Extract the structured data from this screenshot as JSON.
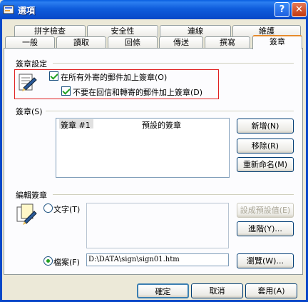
{
  "window": {
    "title": "選項",
    "help": "?",
    "close": "✕"
  },
  "tabs_row1": [
    "拼字檢查",
    "安全性",
    "連線",
    "維護"
  ],
  "tabs_row2": [
    "一般",
    "讀取",
    "回條",
    "傳送",
    "撰寫",
    "簽章"
  ],
  "signature_settings": {
    "label": "簽章設定",
    "add_to_all": "在所有外寄的郵件加上簽章(O)",
    "not_on_reply": "不要在回信和轉寄的郵件加上簽章(D)"
  },
  "signatures": {
    "label": "簽章(S)",
    "items": [
      {
        "name": "簽章 #1",
        "default": "預設的簽章"
      }
    ],
    "new": "新增(N)",
    "remove": "移除(R)",
    "rename": "重新命名(M)"
  },
  "edit_signature": {
    "label": "編輯簽章",
    "text_option": "文字(T)",
    "file_option": "檔案(F)",
    "file_path": "D:\\DATA\\sign\\sign01.htm",
    "set_default": "設成預設值(E)",
    "advanced": "進階(Y)...",
    "browse": "瀏覽(W)..."
  },
  "footer": {
    "ok": "確定",
    "cancel": "取消",
    "apply": "套用(A)"
  }
}
